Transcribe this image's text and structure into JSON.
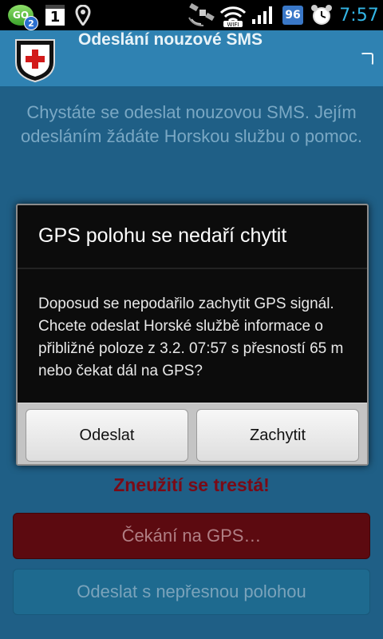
{
  "status_bar": {
    "gosms_label": "GO",
    "gosms_badge": "2",
    "calendar_day": "1",
    "battery_level": "96",
    "time": "7:57"
  },
  "app": {
    "title": "Odeslání nouzové SMS"
  },
  "content": {
    "message": "Chystáte se odeslat nouzovou SMS. Jejím odesláním žádáte Horskou službu o pomoc.",
    "warning": "Zneužití se trestá!",
    "wait_button": "Čekání na GPS…",
    "send_imprecise_button": "Odeslat s nepřesnou polohou"
  },
  "dialog": {
    "title": "GPS polohu se nedaří chytit",
    "message": "Doposud se nepodařilo zachytit GPS signál. Chcete odeslat Horské službě informace o přibližné poloze z 3.2. 07:57 s přesností 65 m nebo čekat dál na GPS?",
    "send_button": "Odeslat",
    "retry_button": "Zachytit"
  },
  "colors": {
    "background": "#1f5f86",
    "appbar": "#2f82b2",
    "warning": "#7a0a16",
    "clock": "#33b5e5"
  }
}
